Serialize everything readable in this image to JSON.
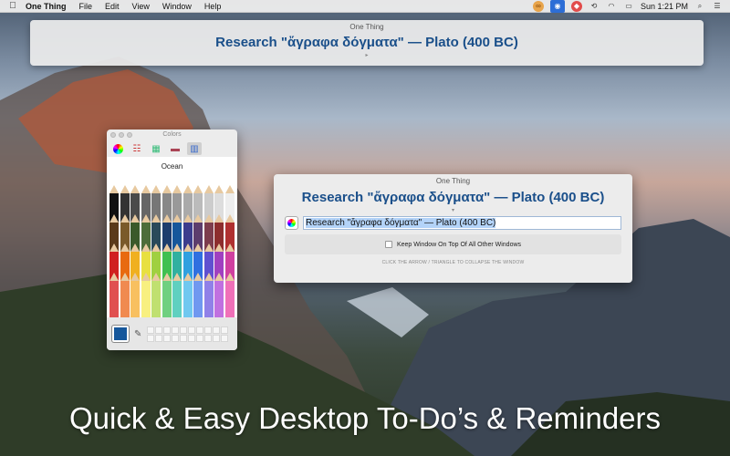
{
  "menubar": {
    "apple_icon": "apple-icon",
    "app_name": "One Thing",
    "items": [
      "File",
      "Edit",
      "View",
      "Window",
      "Help"
    ],
    "clock": "Sun 1:21 PM"
  },
  "top_window": {
    "title": "One Thing",
    "text": "Research \"ἄγραφα δόγματα\" — Plato (400 BC)",
    "arrow": "▸"
  },
  "colors_panel": {
    "title": "Colors",
    "color_name": "Ocean",
    "selected_color": "#16579b"
  },
  "main_window": {
    "title": "One Thing",
    "text": "Research \"ἄγραφα δόγματα\" — Plato (400 BC)",
    "arrow": "▾",
    "field_value": "Research \"ἄγραφα δόγματα\" — Plato (400 BC)",
    "keep_on_top": {
      "label": "Keep Window On Top Of All Other Windows",
      "checked": false
    },
    "hint": "CLICK THE ARROW / TRIANGLE TO COLLAPSE THE WINDOW"
  },
  "caption": "Quick & Easy Desktop To-Do’s & Reminders"
}
